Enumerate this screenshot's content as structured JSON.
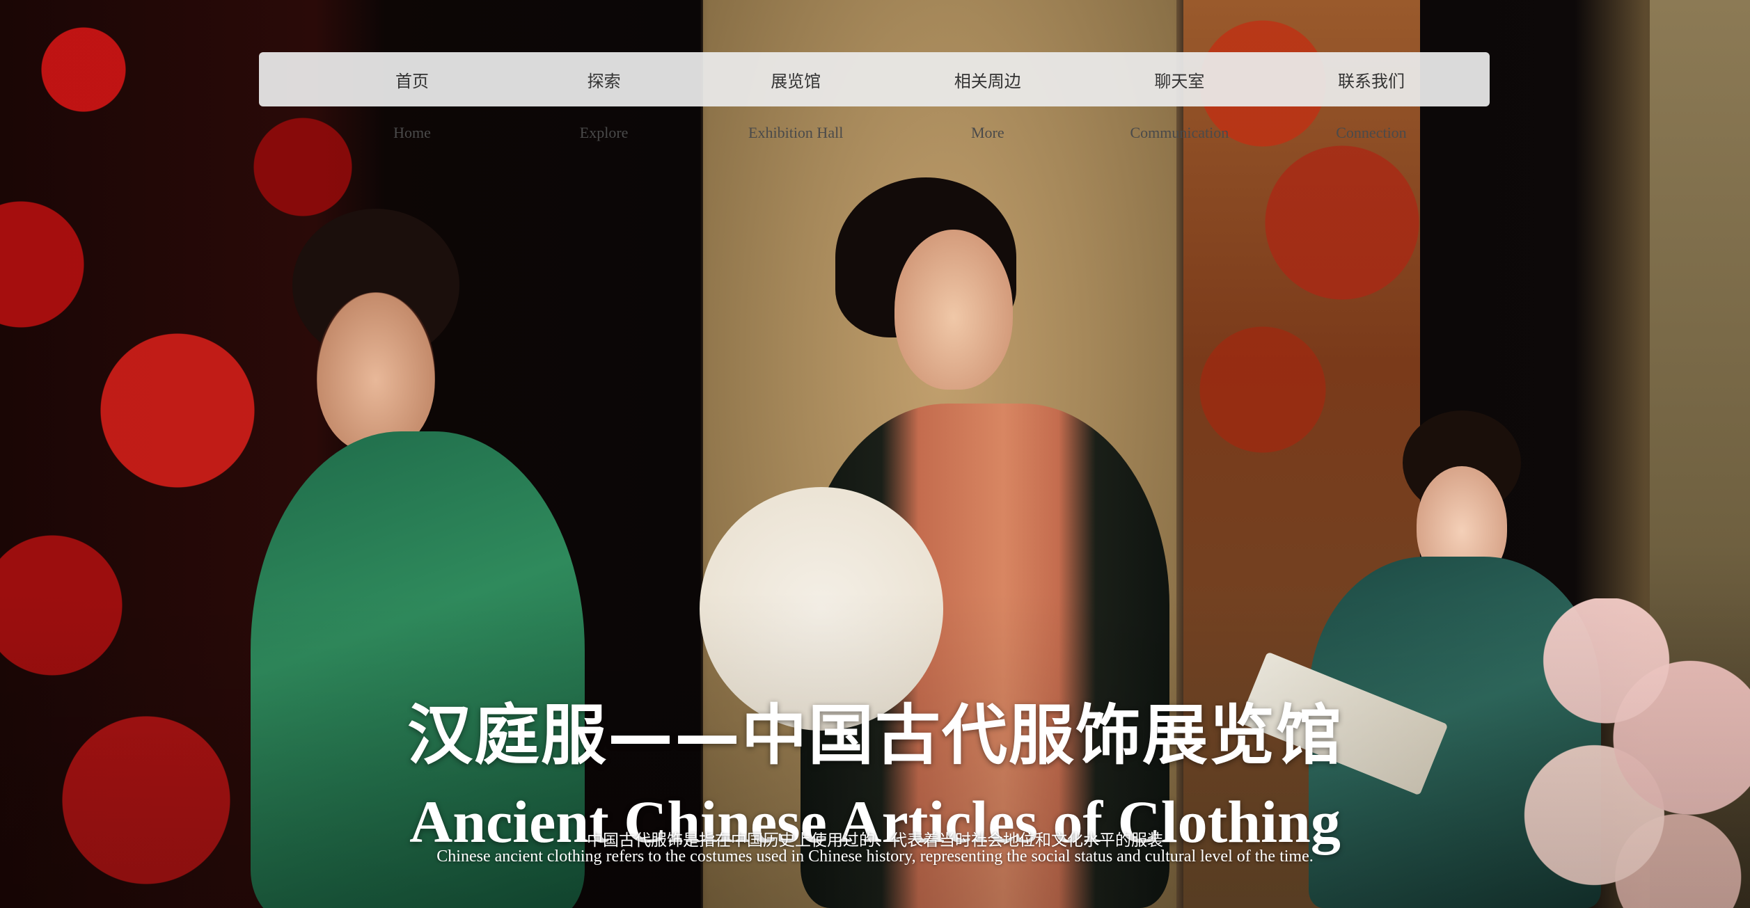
{
  "nav": {
    "items": [
      {
        "label": "首页",
        "sub": "Home"
      },
      {
        "label": "探索",
        "sub": "Explore"
      },
      {
        "label": "展览馆",
        "sub": "Exhibition Hall"
      },
      {
        "label": "相关周边",
        "sub": "More"
      },
      {
        "label": "聊天室",
        "sub": "Communication"
      },
      {
        "label": "联系我们",
        "sub": "Connection"
      }
    ]
  },
  "hero": {
    "title_cn": "汉庭服——中国古代服饰展览馆",
    "title_en": "Ancient Chinese Articles of Clothing",
    "desc_cn": "中国古代服饰是指在中国历史上使用过的、代表着当时社会地位和文化水平的服装",
    "desc_en": "Chinese ancient clothing refers to the costumes used in Chinese history, representing the social status and cultural level of the time."
  },
  "colors": {
    "nav_bg": "#ebebeb",
    "nav_text": "#333333",
    "hero_text": "#ffffff"
  }
}
